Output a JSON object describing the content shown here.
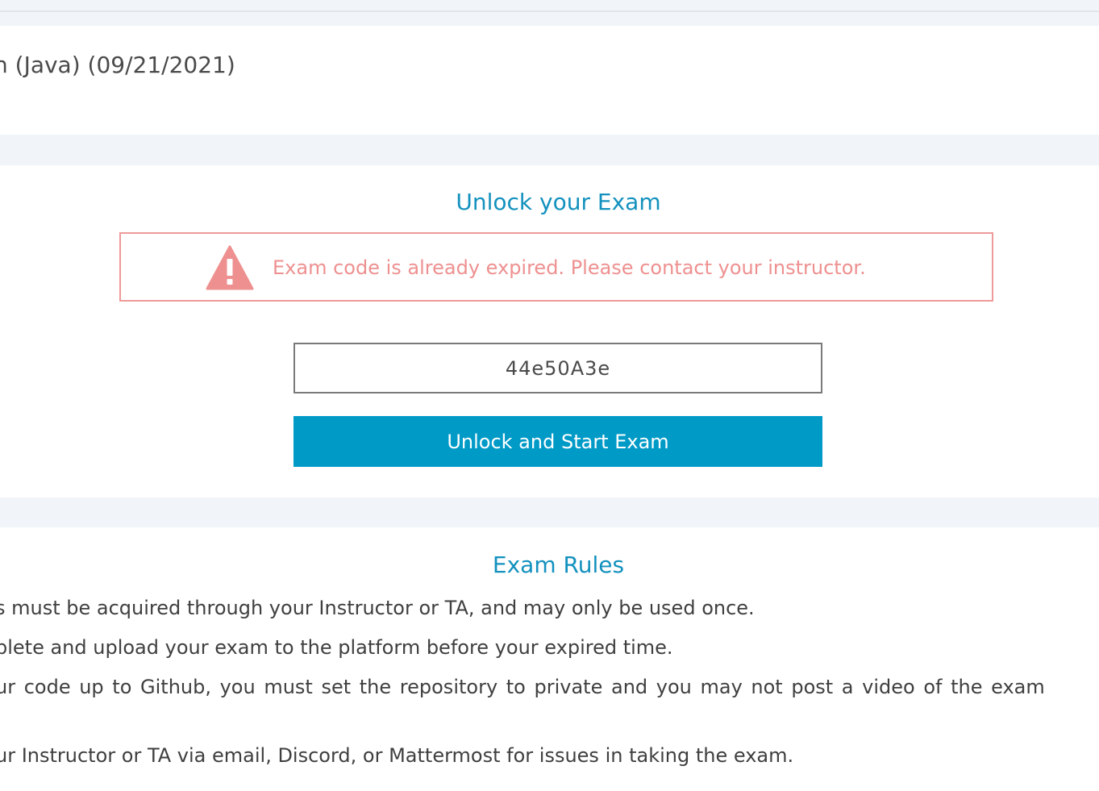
{
  "header": {
    "title_fragment": "n (Java) (09/21/2021)"
  },
  "unlock": {
    "heading": "Unlock your Exam",
    "alert_message": "Exam code is already expired. Please contact your instructor.",
    "alert_icon": "warning-triangle-icon",
    "code_value": "44e50A3e",
    "button_label": "Unlock and Start Exam"
  },
  "rules": {
    "heading": "Exam Rules",
    "items": [
      "s must be acquired through your Instructor or TA, and may only be used once.",
      "plete and upload your exam to the platform before your expired time.",
      "ur code up to Github, you must set the repository to private and you may not post a video of the exam",
      "ur Instructor or TA via email, Discord, or Mattermost for issues in taking the exam."
    ]
  },
  "colors": {
    "accent": "#1391be",
    "button": "#009ac7",
    "alert": "#ee9090",
    "band": "#f1f4f8"
  }
}
